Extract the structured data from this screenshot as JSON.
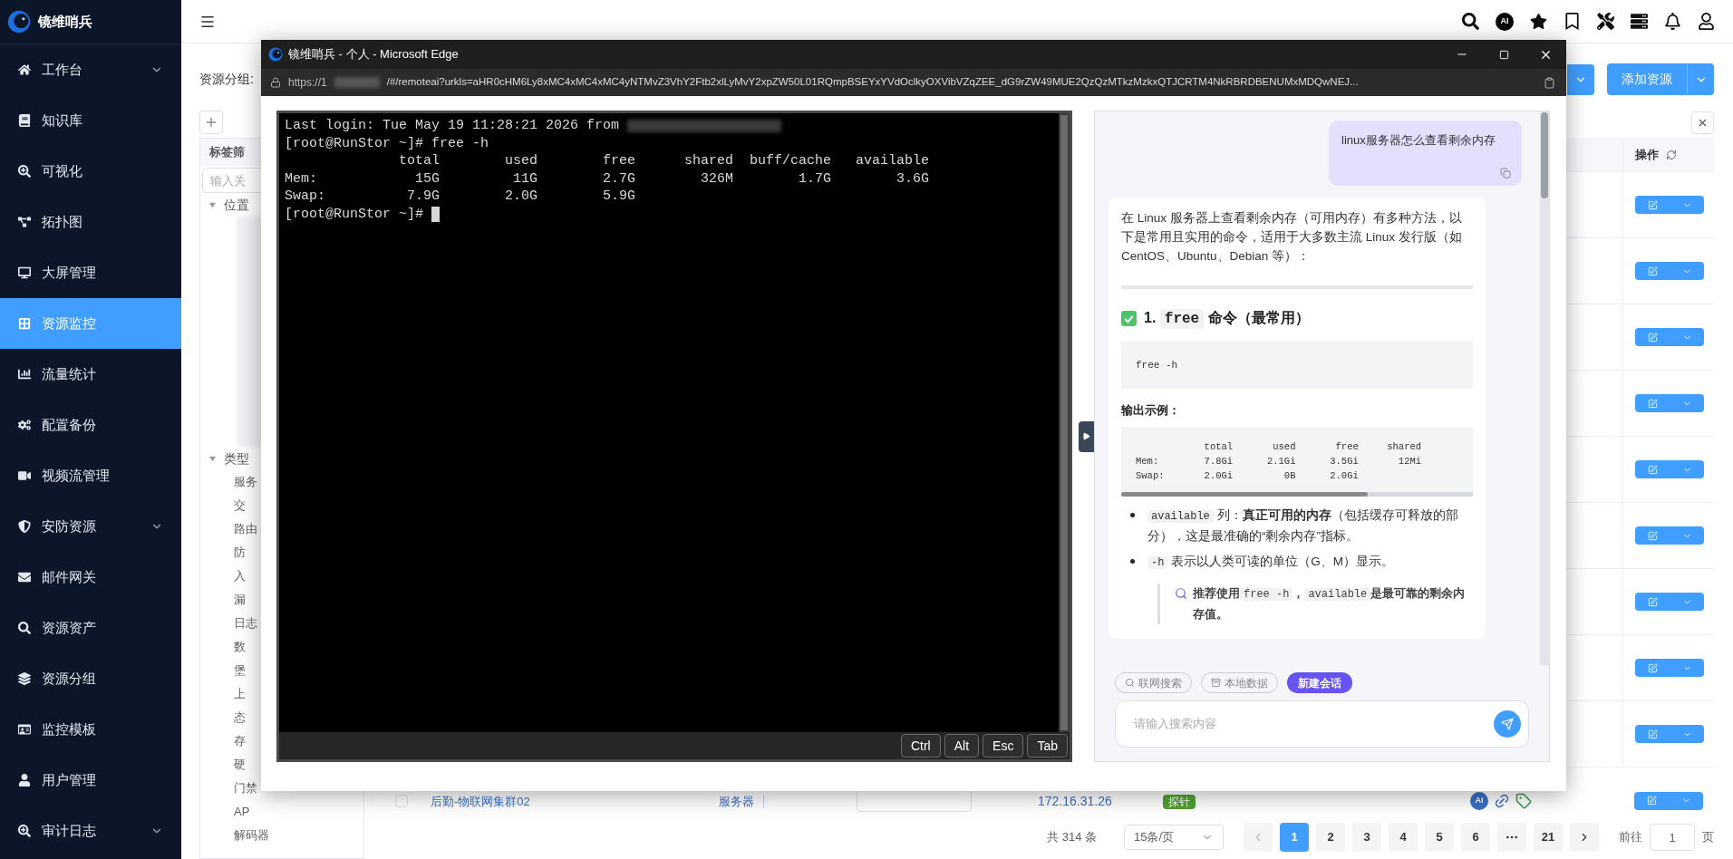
{
  "sidebar": {
    "brand": "镜维哨兵",
    "items": [
      {
        "label": "工作台",
        "selected": false,
        "has_submenu": true
      },
      {
        "label": "知识库",
        "selected": false,
        "has_submenu": false
      },
      {
        "label": "可视化",
        "selected": false,
        "has_submenu": false
      },
      {
        "label": "拓扑图",
        "selected": false,
        "has_submenu": false
      },
      {
        "label": "大屏管理",
        "selected": false,
        "has_submenu": false
      },
      {
        "label": "资源监控",
        "selected": true,
        "has_submenu": false
      },
      {
        "label": "流量统计",
        "selected": false,
        "has_submenu": false
      },
      {
        "label": "配置备份",
        "selected": false,
        "has_submenu": false
      },
      {
        "label": "视频流管理",
        "selected": false,
        "has_submenu": false
      },
      {
        "label": "安防资源",
        "selected": false,
        "has_submenu": true
      },
      {
        "label": "邮件网关",
        "selected": false,
        "has_submenu": false
      },
      {
        "label": "资源资产",
        "selected": false,
        "has_submenu": false
      },
      {
        "label": "资源分组",
        "selected": false,
        "has_submenu": false
      },
      {
        "label": "监控模板",
        "selected": false,
        "has_submenu": false
      },
      {
        "label": "用户管理",
        "selected": false,
        "has_submenu": false
      },
      {
        "label": "审计日志",
        "selected": false,
        "has_submenu": true
      }
    ]
  },
  "header": {
    "ai_label": "AI"
  },
  "toolbar": {
    "group_label": "资源分组:",
    "add_button": "添加资源"
  },
  "tag_panel": {
    "title": "标签筛",
    "search_placeholder": "输入关",
    "tree": [
      {
        "label": "位置",
        "expanded": true,
        "blurred": true
      },
      {
        "label": "类型",
        "expanded": true,
        "blurred": false,
        "children": [
          "服务",
          "交",
          "路由",
          "防",
          "入",
          "漏",
          "日志",
          "数",
          "堡",
          "上",
          "态",
          "存",
          "硬",
          "门禁",
          "AP",
          "解码器"
        ]
      }
    ]
  },
  "table": {
    "action_column": "操作",
    "last_row": {
      "checked": false,
      "name": "后勤-物联网集群02",
      "type": "服务器",
      "ip": "172.16.31.26",
      "badge": "探针",
      "ai_label": "AI"
    }
  },
  "pagination": {
    "total": "共 314 条",
    "page_size": "15条/页",
    "pages": [
      {
        "kind": "page",
        "label": "1",
        "selected": true
      },
      {
        "kind": "page",
        "label": "2",
        "selected": false
      },
      {
        "kind": "page",
        "label": "3",
        "selected": false
      },
      {
        "kind": "page",
        "label": "4",
        "selected": false
      },
      {
        "kind": "page",
        "label": "5",
        "selected": false
      },
      {
        "kind": "page",
        "label": "6",
        "selected": false
      },
      {
        "kind": "more",
        "selected": false
      },
      {
        "kind": "page",
        "label": "21",
        "selected": false
      }
    ],
    "goto_label": "前往",
    "goto_value": "1",
    "page_suffix": "页"
  },
  "modal": {
    "title": "镜维哨兵 - 个人 - Microsoft Edge",
    "url_start": "https://1",
    "url_rest": "/#/remoteai?urkls=aHR0cHM6Ly8xMC4xMC4xMC4yNTMvZ3VhY2Ftb2xlLyMvY2xpZW50L01RQmpBSEYxYVdOclkyOXVibVZqZEE_dG9rZW49MUE2QzQzMTkzMzkxQTJCRTM4NkRBRDBENUMxMDQwNEJ...",
    "terminal": {
      "login_line": "Last login: Tue May 19 11:28:21 2026 from",
      "lines": [
        "[root@RunStor ~]# free -h",
        "              total        used        free      shared  buff/cache   available",
        "Mem:            15G         11G        2.7G        326M        1.7G        3.6G",
        "Swap:          7.9G        2.0G        5.9G"
      ],
      "prompt": "[root@RunStor ~]#",
      "keys": [
        "Ctrl",
        "Alt",
        "Esc",
        "Tab"
      ]
    },
    "chat": {
      "user_message": "linux服务器怎么查看剩余内存",
      "answer": {
        "intro": "在 Linux 服务器上查看剩余内存（可用内存）有多种方法，以下是常用且实用的命令，适用于大多数主流 Linux 发行版（如CentOS、Ubuntu、Debian 等）：",
        "heading": {
          "number": "1.",
          "code": "free",
          "text": "命令（最常用）"
        },
        "command": "free -h",
        "output_label": "输出示例：",
        "output_lines": [
          "            total       used       free     shared",
          "Mem:        7.8Gi      2.1Gi      3.5Gi       12Mi",
          "Swap:       2.0Gi         0B      2.0Gi"
        ],
        "bullets": [
          {
            "code": "available",
            "text": "列：**真正可用的内存**（包括缓存可释放的部分），这是最准确的“剩余内存”指标。"
          },
          {
            "code": "-h",
            "text": "表示以人类可读的单位（G、M）显示。"
          }
        ],
        "tip": [
          {
            "kind": "text",
            "text": "推荐使用"
          },
          {
            "kind": "code",
            "text": "free -h"
          },
          {
            "kind": "text",
            "text": "，"
          },
          {
            "kind": "code",
            "text": "available"
          },
          {
            "kind": "text",
            "text": "是最可靠的剩余内存值。"
          }
        ]
      },
      "chips": [
        {
          "kind": "search",
          "label": "联网搜索"
        },
        {
          "kind": "data",
          "label": "本地数据"
        },
        {
          "kind": "new",
          "label": "新建会话"
        }
      ],
      "input_placeholder": "请输入搜索内容"
    }
  }
}
